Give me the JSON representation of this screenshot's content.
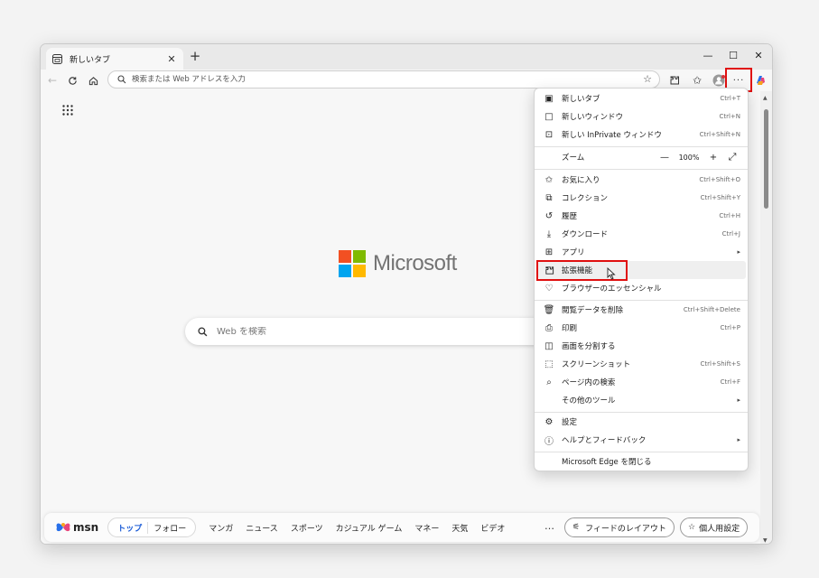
{
  "tab": {
    "title": "新しいタブ",
    "close": "✕"
  },
  "window_controls": {
    "minimize": "—",
    "maximize": "☐",
    "close": "✕"
  },
  "address_bar": {
    "placeholder": "検索または Web アドレスを入力",
    "value": ""
  },
  "page": {
    "brand": "Microsoft",
    "search_placeholder": "Web を検索"
  },
  "msn": {
    "logo": "msn",
    "pills": [
      "トップ",
      "フォロー"
    ],
    "categories": [
      "マンガ",
      "ニュース",
      "スポーツ",
      "カジュアル ゲーム",
      "マネー",
      "天気",
      "ビデオ"
    ],
    "more": "…",
    "feed_layout": "フィードのレイアウト",
    "personalize": "個人用設定"
  },
  "menu": {
    "new_tab": {
      "label": "新しいタブ",
      "shortcut": "Ctrl+T"
    },
    "new_window": {
      "label": "新しいウィンドウ",
      "shortcut": "Ctrl+N"
    },
    "new_inprivate": {
      "label": "新しい InPrivate ウィンドウ",
      "shortcut": "Ctrl+Shift+N"
    },
    "zoom": {
      "label": "ズーム",
      "value": "100%",
      "minus": "—",
      "plus": "+"
    },
    "favorites": {
      "label": "お気に入り",
      "shortcut": "Ctrl+Shift+O"
    },
    "collections": {
      "label": "コレクション",
      "shortcut": "Ctrl+Shift+Y"
    },
    "history": {
      "label": "履歴",
      "shortcut": "Ctrl+H"
    },
    "downloads": {
      "label": "ダウンロード",
      "shortcut": "Ctrl+J"
    },
    "apps": {
      "label": "アプリ"
    },
    "extensions": {
      "label": "拡張機能"
    },
    "browser_essentials": {
      "label": "ブラウザーのエッセンシャル"
    },
    "clear_data": {
      "label": "閲覧データを削除",
      "shortcut": "Ctrl+Shift+Delete"
    },
    "print": {
      "label": "印刷",
      "shortcut": "Ctrl+P"
    },
    "split_screen": {
      "label": "画面を分割する"
    },
    "screenshot": {
      "label": "スクリーンショット",
      "shortcut": "Ctrl+Shift+S"
    },
    "find_on_page": {
      "label": "ページ内の検索",
      "shortcut": "Ctrl+F"
    },
    "more_tools": {
      "label": "その他のツール"
    },
    "settings": {
      "label": "設定"
    },
    "help": {
      "label": "ヘルプとフィードバック"
    },
    "close_edge": {
      "label": "Microsoft Edge を閉じる"
    }
  },
  "colors": {
    "highlight": "#e01010",
    "ms_red": "#f25022",
    "ms_green": "#7fba00",
    "ms_blue": "#00a4ef",
    "ms_yellow": "#ffb900"
  }
}
